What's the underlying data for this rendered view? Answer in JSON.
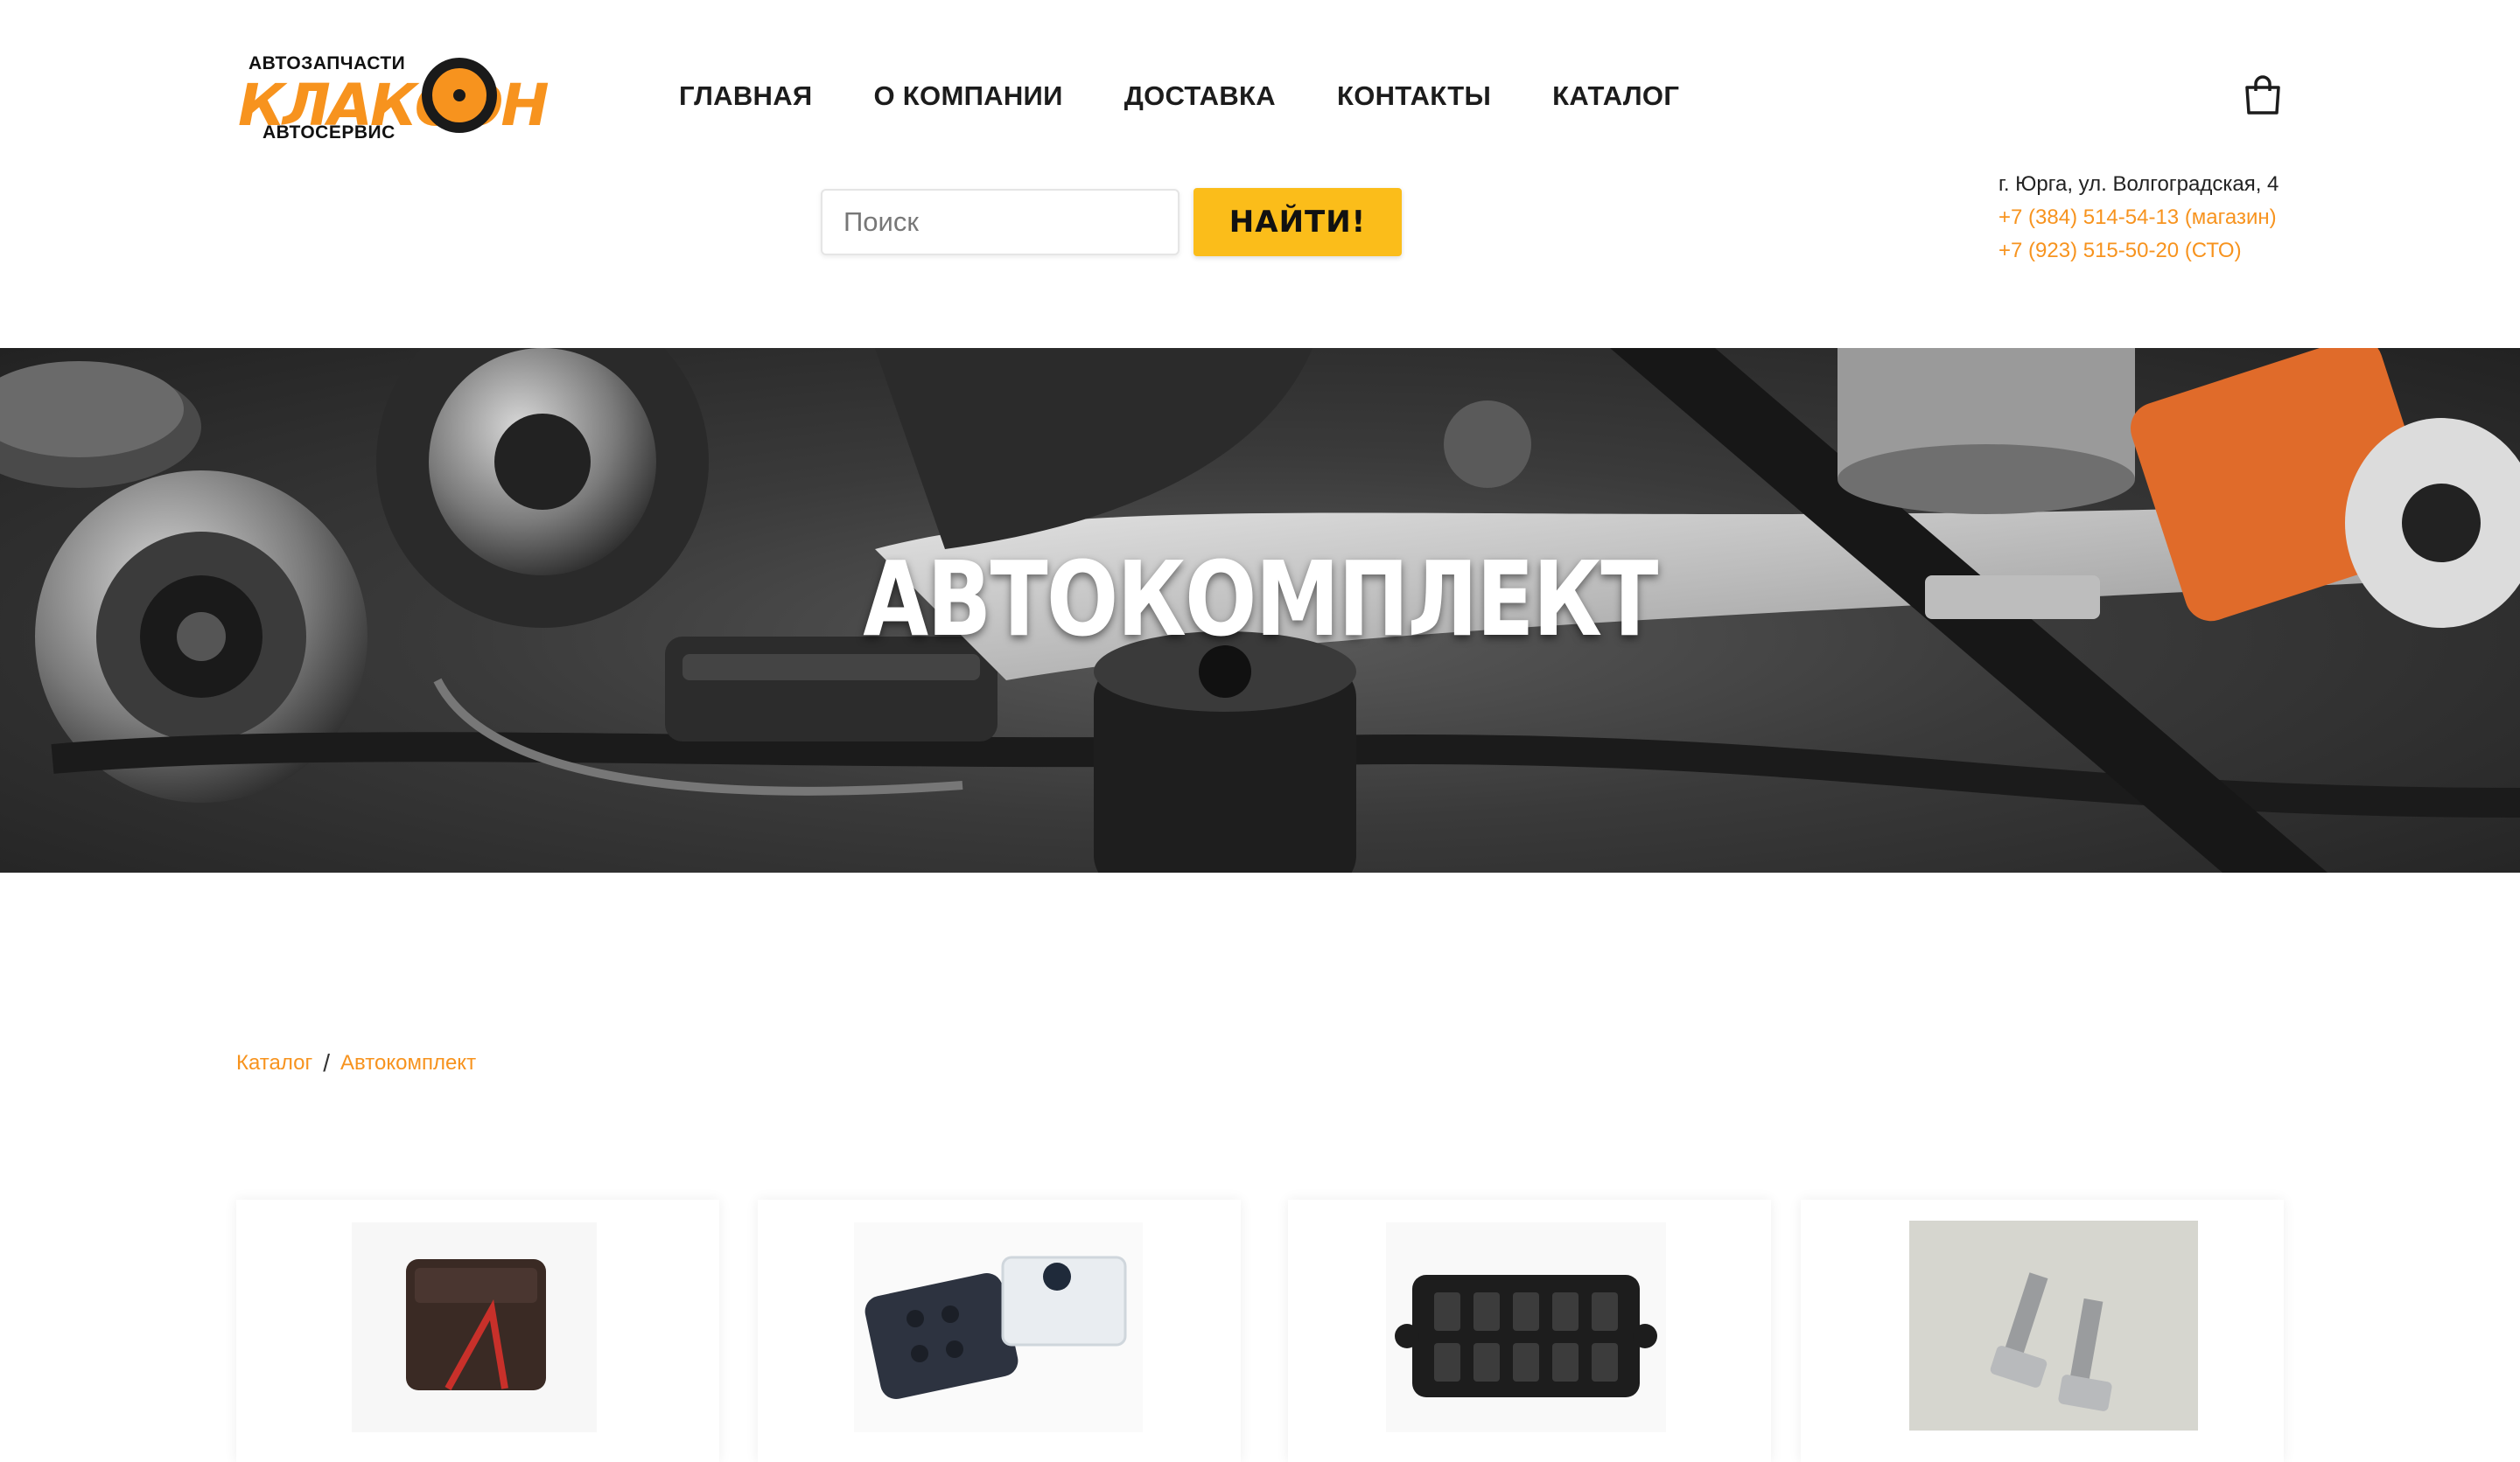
{
  "logo": {
    "top_text": "АВТОЗАПЧАСТИ",
    "brand": "КЛАКСОН",
    "bottom_text": "АВТОСЕРВИС"
  },
  "nav": {
    "items": [
      "ГЛАВНАЯ",
      "О КОМПАНИИ",
      "ДОСТАВКА",
      "КОНТАКТЫ",
      "КАТАЛОГ"
    ]
  },
  "search": {
    "placeholder": "Поиск",
    "button_label": "НАЙТИ!"
  },
  "contacts": {
    "address": "г. Юрга, ул. Волгоградская, 4",
    "phone_1": "+7 (384) 514-54-13 (магазин)",
    "phone_2": "+7 (923) 515-50-20 (СТО)"
  },
  "hero": {
    "title": "АВТОКОМПЛЕКТ"
  },
  "breadcrumb": {
    "items": [
      "Каталог",
      "Автокомплект"
    ],
    "separator": "/"
  },
  "products": {
    "count_visible": 4
  },
  "colors": {
    "accent": "#f7931e",
    "button": "#fbbd1a"
  }
}
